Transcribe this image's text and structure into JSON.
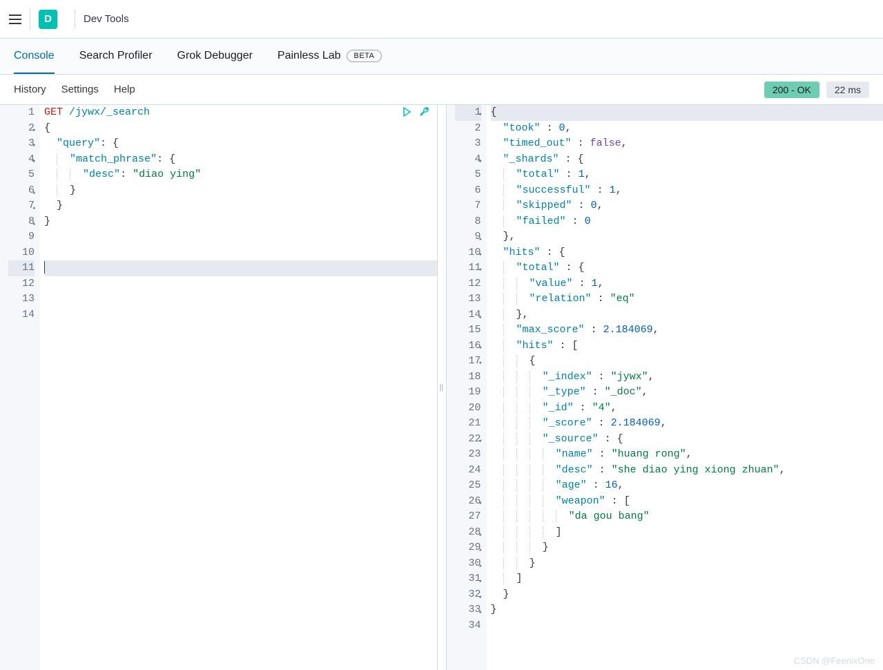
{
  "header": {
    "logo_letter": "D",
    "title": "Dev Tools"
  },
  "tabs": [
    {
      "label": "Console",
      "active": true
    },
    {
      "label": "Search Profiler",
      "active": false
    },
    {
      "label": "Grok Debugger",
      "active": false
    },
    {
      "label": "Painless Lab",
      "active": false,
      "badge": "BETA"
    }
  ],
  "toolbar": {
    "items": [
      "History",
      "Settings",
      "Help"
    ],
    "status": "200 - OK",
    "time": "22 ms"
  },
  "request": {
    "method": "GET",
    "path": "/jywx/_search",
    "lines": [
      {
        "n": 1,
        "fold": "",
        "tokens": [
          [
            "method",
            "GET"
          ],
          [
            "text",
            " "
          ],
          [
            "path",
            "/jywx/_search"
          ]
        ]
      },
      {
        "n": 2,
        "fold": "▾",
        "tokens": [
          [
            "punc",
            "{"
          ]
        ]
      },
      {
        "n": 3,
        "fold": "▾",
        "indent": 1,
        "tokens": [
          [
            "key",
            "\"query\""
          ],
          [
            "punc",
            ": {"
          ]
        ]
      },
      {
        "n": 4,
        "fold": "▾",
        "indent": 2,
        "guide": 1,
        "tokens": [
          [
            "key",
            "\"match_phrase\""
          ],
          [
            "punc",
            ": {"
          ]
        ]
      },
      {
        "n": 5,
        "fold": "",
        "indent": 3,
        "guide": 2,
        "tokens": [
          [
            "key",
            "\"desc\""
          ],
          [
            "punc",
            ": "
          ],
          [
            "str",
            "\"diao ying\""
          ]
        ]
      },
      {
        "n": 6,
        "fold": "▴",
        "indent": 2,
        "guide": 1,
        "tokens": [
          [
            "punc",
            "}"
          ]
        ]
      },
      {
        "n": 7,
        "fold": "▴",
        "indent": 1,
        "tokens": [
          [
            "punc",
            "}"
          ]
        ]
      },
      {
        "n": 8,
        "fold": "▴",
        "tokens": [
          [
            "punc",
            "}"
          ]
        ]
      },
      {
        "n": 9
      },
      {
        "n": 10
      },
      {
        "n": 11,
        "hl": true,
        "cursor": true
      },
      {
        "n": 12
      },
      {
        "n": 13
      },
      {
        "n": 14
      }
    ]
  },
  "response": {
    "lines": [
      {
        "n": 1,
        "fold": "▾",
        "hl": true,
        "tokens": [
          [
            "punc",
            "{"
          ]
        ]
      },
      {
        "n": 2,
        "indent": 1,
        "tokens": [
          [
            "key",
            "\"took\""
          ],
          [
            "punc",
            " : "
          ],
          [
            "num",
            "0"
          ],
          [
            "punc",
            ","
          ]
        ]
      },
      {
        "n": 3,
        "indent": 1,
        "tokens": [
          [
            "key",
            "\"timed_out\""
          ],
          [
            "punc",
            " : "
          ],
          [
            "bool",
            "false"
          ],
          [
            "punc",
            ","
          ]
        ]
      },
      {
        "n": 4,
        "fold": "▾",
        "indent": 1,
        "tokens": [
          [
            "key",
            "\"_shards\""
          ],
          [
            "punc",
            " : {"
          ]
        ]
      },
      {
        "n": 5,
        "indent": 2,
        "guide": 1,
        "tokens": [
          [
            "key",
            "\"total\""
          ],
          [
            "punc",
            " : "
          ],
          [
            "num",
            "1"
          ],
          [
            "punc",
            ","
          ]
        ]
      },
      {
        "n": 6,
        "indent": 2,
        "guide": 1,
        "tokens": [
          [
            "key",
            "\"successful\""
          ],
          [
            "punc",
            " : "
          ],
          [
            "num",
            "1"
          ],
          [
            "punc",
            ","
          ]
        ]
      },
      {
        "n": 7,
        "indent": 2,
        "guide": 1,
        "tokens": [
          [
            "key",
            "\"skipped\""
          ],
          [
            "punc",
            " : "
          ],
          [
            "num",
            "0"
          ],
          [
            "punc",
            ","
          ]
        ]
      },
      {
        "n": 8,
        "indent": 2,
        "guide": 1,
        "tokens": [
          [
            "key",
            "\"failed\""
          ],
          [
            "punc",
            " : "
          ],
          [
            "num",
            "0"
          ]
        ]
      },
      {
        "n": 9,
        "fold": "▴",
        "indent": 1,
        "tokens": [
          [
            "punc",
            "},"
          ]
        ]
      },
      {
        "n": 10,
        "fold": "▾",
        "indent": 1,
        "tokens": [
          [
            "key",
            "\"hits\""
          ],
          [
            "punc",
            " : {"
          ]
        ]
      },
      {
        "n": 11,
        "fold": "▾",
        "indent": 2,
        "guide": 1,
        "tokens": [
          [
            "key",
            "\"total\""
          ],
          [
            "punc",
            " : {"
          ]
        ]
      },
      {
        "n": 12,
        "indent": 3,
        "guide": 2,
        "tokens": [
          [
            "key",
            "\"value\""
          ],
          [
            "punc",
            " : "
          ],
          [
            "num",
            "1"
          ],
          [
            "punc",
            ","
          ]
        ]
      },
      {
        "n": 13,
        "indent": 3,
        "guide": 2,
        "tokens": [
          [
            "key",
            "\"relation\""
          ],
          [
            "punc",
            " : "
          ],
          [
            "str",
            "\"eq\""
          ]
        ]
      },
      {
        "n": 14,
        "fold": "▴",
        "indent": 2,
        "guide": 1,
        "tokens": [
          [
            "punc",
            "},"
          ]
        ]
      },
      {
        "n": 15,
        "indent": 2,
        "guide": 1,
        "tokens": [
          [
            "key",
            "\"max_score\""
          ],
          [
            "punc",
            " : "
          ],
          [
            "num",
            "2.184069"
          ],
          [
            "punc",
            ","
          ]
        ]
      },
      {
        "n": 16,
        "fold": "▾",
        "indent": 2,
        "guide": 1,
        "tokens": [
          [
            "key",
            "\"hits\""
          ],
          [
            "punc",
            " : ["
          ]
        ]
      },
      {
        "n": 17,
        "fold": "▾",
        "indent": 3,
        "guide": 2,
        "tokens": [
          [
            "punc",
            "{"
          ]
        ]
      },
      {
        "n": 18,
        "indent": 4,
        "guide": 3,
        "tokens": [
          [
            "key",
            "\"_index\""
          ],
          [
            "punc",
            " : "
          ],
          [
            "str",
            "\"jywx\""
          ],
          [
            "punc",
            ","
          ]
        ]
      },
      {
        "n": 19,
        "indent": 4,
        "guide": 3,
        "tokens": [
          [
            "key",
            "\"_type\""
          ],
          [
            "punc",
            " : "
          ],
          [
            "str",
            "\"_doc\""
          ],
          [
            "punc",
            ","
          ]
        ]
      },
      {
        "n": 20,
        "indent": 4,
        "guide": 3,
        "tokens": [
          [
            "key",
            "\"_id\""
          ],
          [
            "punc",
            " : "
          ],
          [
            "str",
            "\"4\""
          ],
          [
            "punc",
            ","
          ]
        ]
      },
      {
        "n": 21,
        "indent": 4,
        "guide": 3,
        "tokens": [
          [
            "key",
            "\"_score\""
          ],
          [
            "punc",
            " : "
          ],
          [
            "num",
            "2.184069"
          ],
          [
            "punc",
            ","
          ]
        ]
      },
      {
        "n": 22,
        "fold": "▾",
        "indent": 4,
        "guide": 3,
        "tokens": [
          [
            "key",
            "\"_source\""
          ],
          [
            "punc",
            " : {"
          ]
        ]
      },
      {
        "n": 23,
        "indent": 5,
        "guide": 4,
        "tokens": [
          [
            "key",
            "\"name\""
          ],
          [
            "punc",
            " : "
          ],
          [
            "str",
            "\"huang rong\""
          ],
          [
            "punc",
            ","
          ]
        ]
      },
      {
        "n": 24,
        "indent": 5,
        "guide": 4,
        "tokens": [
          [
            "key",
            "\"desc\""
          ],
          [
            "punc",
            " : "
          ],
          [
            "str",
            "\"she diao ying xiong zhuan\""
          ],
          [
            "punc",
            ","
          ]
        ]
      },
      {
        "n": 25,
        "indent": 5,
        "guide": 4,
        "tokens": [
          [
            "key",
            "\"age\""
          ],
          [
            "punc",
            " : "
          ],
          [
            "num",
            "16"
          ],
          [
            "punc",
            ","
          ]
        ]
      },
      {
        "n": 26,
        "fold": "▾",
        "indent": 5,
        "guide": 4,
        "tokens": [
          [
            "key",
            "\"weapon\""
          ],
          [
            "punc",
            " : ["
          ]
        ]
      },
      {
        "n": 27,
        "indent": 6,
        "guide": 5,
        "tokens": [
          [
            "str",
            "\"da gou bang\""
          ]
        ]
      },
      {
        "n": 28,
        "fold": "▴",
        "indent": 5,
        "guide": 4,
        "tokens": [
          [
            "punc",
            "]"
          ]
        ]
      },
      {
        "n": 29,
        "fold": "▴",
        "indent": 4,
        "guide": 3,
        "tokens": [
          [
            "punc",
            "}"
          ]
        ]
      },
      {
        "n": 30,
        "fold": "▴",
        "indent": 3,
        "guide": 2,
        "tokens": [
          [
            "punc",
            "}"
          ]
        ]
      },
      {
        "n": 31,
        "fold": "▴",
        "indent": 2,
        "guide": 1,
        "tokens": [
          [
            "punc",
            "]"
          ]
        ]
      },
      {
        "n": 32,
        "fold": "▴",
        "indent": 1,
        "tokens": [
          [
            "punc",
            "}"
          ]
        ]
      },
      {
        "n": 33,
        "fold": "▴",
        "tokens": [
          [
            "punc",
            "}"
          ]
        ]
      },
      {
        "n": 34
      }
    ]
  },
  "watermark": "CSDN @FeenixOne"
}
